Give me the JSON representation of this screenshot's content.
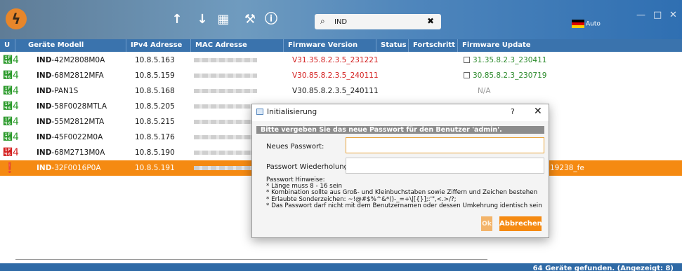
{
  "toolbar": {
    "logo": "ϟ",
    "upload_icon": "↑",
    "download_icon": "↓",
    "calculator_icon": "▦",
    "tools_icon": "⚒",
    "info_icon": "ⓘ",
    "search_icon": "⌕",
    "search_value": "IND",
    "clear_icon": "✖",
    "language": "Auto",
    "minimize": "—",
    "maximize": "□",
    "close": "✕"
  },
  "table": {
    "headers": [
      "U",
      "Geräte Modell",
      "IPv4 Adresse",
      "MAC Adresse",
      "Firmware Version",
      "Status",
      "Fortschritt",
      "Firmware Update"
    ],
    "rows": [
      {
        "icon": "὆4",
        "icon_color": "#2b9a2b",
        "model_bold": "IND",
        "model_rest": "-42M2808M0A",
        "ip": "10.8.5.163",
        "fw": "V31.35.8.2.3.5_231221",
        "fw_color": "#d42020",
        "update": "31.35.8.2.3_230411",
        "update_color": "#2b8a2b",
        "checkbox": true
      },
      {
        "icon": "὆4",
        "icon_color": "#2b9a2b",
        "model_bold": "IND",
        "model_rest": "-68M2812MFA",
        "ip": "10.8.5.159",
        "fw": "V30.85.8.2.3.5_240111",
        "fw_color": "#d42020",
        "update": "30.85.8.2.3_230719",
        "update_color": "#2b8a2b",
        "checkbox": true
      },
      {
        "icon": "὆4",
        "icon_color": "#2b9a2b",
        "model_bold": "IND",
        "model_rest": "-PAN1S",
        "ip": "10.8.5.168",
        "fw": "V30.85.8.2.3.5_240111",
        "fw_color": "#1a1a1a",
        "update": "N/A",
        "update_color": "#999999",
        "checkbox": false
      },
      {
        "icon": "὆4",
        "icon_color": "#2b9a2b",
        "model_bold": "IND",
        "model_rest": "-58F0028MTLA",
        "ip": "10.8.5.205",
        "fw": "",
        "fw_color": "#1a1a1a",
        "update": "",
        "update_color": "#1a1a1a",
        "checkbox": false
      },
      {
        "icon": "὆4",
        "icon_color": "#2b9a2b",
        "model_bold": "IND",
        "model_rest": "-55M2812MTA",
        "ip": "10.8.5.215",
        "fw": "",
        "fw_color": "#1a1a1a",
        "update": "",
        "update_color": "#1a1a1a",
        "checkbox": false
      },
      {
        "icon": "὆4",
        "icon_color": "#2b9a2b",
        "model_bold": "IND",
        "model_rest": "-45F0022M0A",
        "ip": "10.8.5.176",
        "fw": "",
        "fw_color": "#1a1a1a",
        "update": "",
        "update_color": "#1a1a1a",
        "checkbox": false
      },
      {
        "icon": "὆4",
        "icon_color": "#d42020",
        "model_bold": "IND",
        "model_rest": "-68M2713M0A",
        "ip": "10.8.5.190",
        "fw": "",
        "fw_color": "#1a1a1a",
        "update": "",
        "update_color": "#1a1a1a",
        "checkbox": false
      },
      {
        "icon": "❗",
        "icon_color": "#ffffff",
        "model_bold": "IND",
        "model_rest": "-32F0016P0A",
        "ip": "10.8.5.191",
        "fw": "",
        "fw_color": "#ffffff",
        "update": "19238_fe",
        "update_color": "#ffffff",
        "checkbox": false,
        "selected": true
      }
    ]
  },
  "status": {
    "text": "64 Geräte gefunden. (Angezeigt: 8)"
  },
  "dialog": {
    "title": "Initialisierung",
    "help": "?",
    "close": "✕",
    "banner": "Bitte vergeben Sie das neue Passwort für den Benutzer 'admin'.",
    "new_password_label": "Neues Passwort:",
    "repeat_password_label": "Passwort Wiederholung:",
    "hints": [
      "Passwort Hinweise:",
      "* Länge muss 8 - 16 sein",
      "* Kombination sollte aus Groß- und Kleinbuchstaben sowie Ziffern und Zeichen bestehen",
      "* Erlaubte Sonderzeichen: ~!@#$%^&*()-_=+\\|[{}];:'\",<.>/?;",
      "* Das Passwort darf nicht mit dem Benutzernamen oder dessen Umkehrung identisch sein"
    ],
    "ok_label": "Ok",
    "cancel_label": "Abbrechen"
  }
}
